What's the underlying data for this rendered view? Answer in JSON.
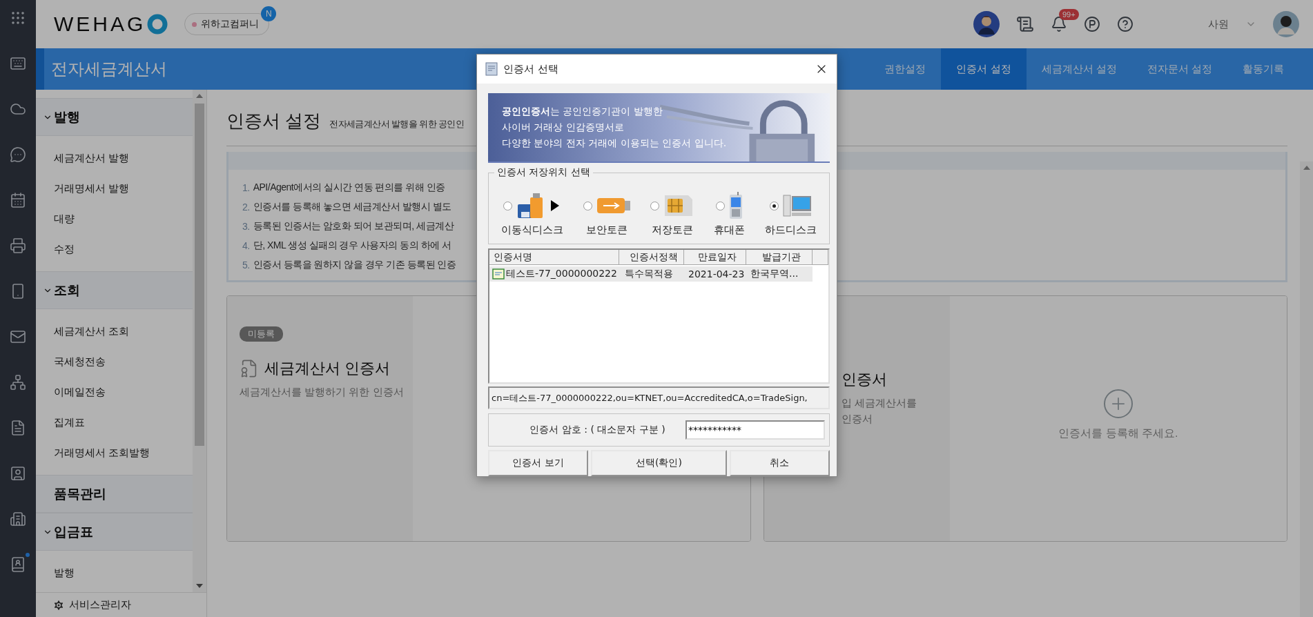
{
  "rail": [
    {
      "notification": false
    },
    {
      "notification": false
    },
    {
      "notification": false
    },
    {
      "notification": false
    },
    {
      "notification": false
    },
    {
      "notification": false
    },
    {
      "notification": false
    },
    {
      "notification": false
    },
    {
      "notification": false
    },
    {
      "notification": false
    },
    {
      "notification": false
    },
    {
      "notification": false
    },
    {
      "notification": true
    }
  ],
  "header": {
    "logo": "WEHAG",
    "company": {
      "name": "위하고컴퍼니",
      "badge": "N"
    },
    "notifications": "99+",
    "user_role": "사원"
  },
  "app_bar": {
    "title": "전자세금계산서",
    "tabs": [
      {
        "label": "권한설정",
        "selected": false
      },
      {
        "label": "인증서 설정",
        "selected": true
      },
      {
        "label": "세금계산서 설정",
        "selected": false
      },
      {
        "label": "전자문서 설정",
        "selected": false
      },
      {
        "label": "활동기록",
        "selected": false
      }
    ]
  },
  "sidebar": {
    "sections": [
      {
        "title": "발행",
        "kind": "group",
        "expanded": true,
        "items": [
          "세금계산서 발행",
          "거래명세서 발행",
          "대량",
          "수정"
        ]
      },
      {
        "title": "조회",
        "kind": "group",
        "expanded": true,
        "items": [
          "세금계산서 조회",
          "국세청전송",
          "이메일전송",
          "집계표",
          "거래명세서 조회발행"
        ]
      },
      {
        "title": "품목관리",
        "kind": "single"
      },
      {
        "title": "입금표",
        "kind": "group",
        "expanded": true,
        "items": [
          "발행"
        ]
      }
    ],
    "footer": "서비스관리자"
  },
  "content": {
    "title": "인증서 설정",
    "subtitle": "전자세금계산서 발행을 위한 공인인",
    "notices": [
      {
        "number": "1.",
        "text": "API/Agent에서의 실시간 연동 편의를 위해 인증"
      },
      {
        "number": "2.",
        "text": "인증서를 등록해 놓으면 세금계산서 발행시 별도"
      },
      {
        "number": "3.",
        "text": "등록된 인증서는 암호화 되어 보관되며, 세금계산"
      },
      {
        "number": "4.",
        "text": "단, XML 생성 실패의 경우 사용자의 동의 하에 서"
      },
      {
        "number": "5.",
        "text": "인증서 등록을 원하지 않을 경우 기존 등록된 인증"
      }
    ],
    "cards": [
      {
        "badge": "미등록",
        "title": "세금계산서 인증서",
        "description": [
          "세금계산서를 발행하기 위한 인증서"
        ]
      },
      {
        "title": "인증서",
        "description": [
          "입 세금계산서를",
          "인증서"
        ],
        "empty_message": "인증서를 등록해 주세요."
      }
    ]
  },
  "dialog": {
    "title": "인증서 선택",
    "banner": [
      "**공인인증서**는 공인인증기관이 발행한",
      "사이버 거래상 인감증명서로",
      "다양한 분야의 전자 거래에 이용되는 인증서 입니다."
    ],
    "location": {
      "legend": "인증서 저장위치 선택",
      "options": [
        {
          "label": "이동식디스크",
          "kind": "removable",
          "selected": false
        },
        {
          "label": "보안토큰",
          "kind": "token",
          "selected": false
        },
        {
          "label": "저장토큰",
          "kind": "chip",
          "selected": false
        },
        {
          "label": "휴대폰",
          "kind": "phone",
          "selected": false
        },
        {
          "label": "하드디스크",
          "kind": "disk",
          "selected": true
        }
      ]
    },
    "table": {
      "columns": [
        "인증서명",
        "인증서정책",
        "만료일자",
        "발급기관"
      ],
      "rows": [
        {
          "cells": [
            "테스트-77_0000000222",
            "특수목적용",
            "2021-04-23",
            "한국무역..."
          ],
          "selected": true
        }
      ]
    },
    "subject": "cn=테스트-77_0000000222,ou=KTNET,ou=AccreditedCA,o=TradeSign,",
    "password": {
      "label": "인증서 암호 : ( 대소문자 구분 )",
      "value": "***********"
    },
    "buttons": [
      "인증서 보기",
      "선택(확인)",
      "취소"
    ]
  }
}
